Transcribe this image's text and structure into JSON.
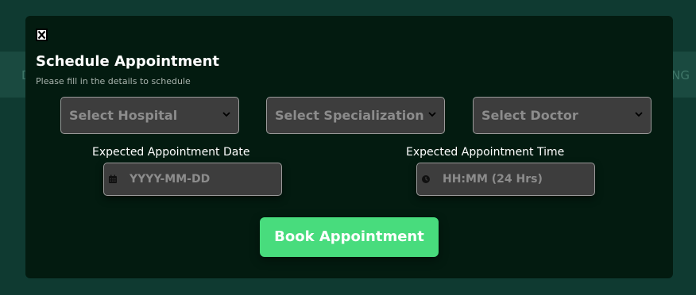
{
  "background": {
    "left_text": "D",
    "right_text": "NG"
  },
  "modal": {
    "title": "Schedule Appointment",
    "subtitle": "Please fill in the details to schedule"
  },
  "selects": {
    "hospital": {
      "selected": "Select Hospital"
    },
    "specialization": {
      "selected": "Select Specialization"
    },
    "doctor": {
      "selected": "Select Doctor"
    }
  },
  "date_field": {
    "label": "Expected Appointment Date",
    "placeholder": "YYYY-MM-DD",
    "icon": "calendar-icon"
  },
  "time_field": {
    "label": "Expected Appointment Time",
    "placeholder": "HH:MM (24 Hrs)",
    "icon": "clock-icon"
  },
  "actions": {
    "book_label": "Book Appointment"
  },
  "colors": {
    "page_bg": "#0f3a31",
    "modal_bg": "#031b10",
    "field_bg": "#3d3d3d",
    "accent": "#48dc7d"
  }
}
